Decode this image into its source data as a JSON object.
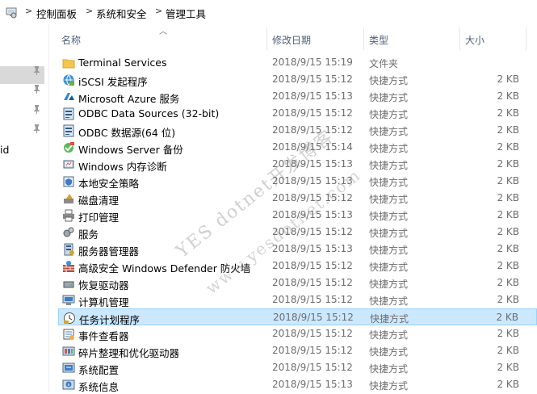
{
  "breadcrumb": {
    "items": [
      "控制面板",
      "系统和安全",
      "管理工具"
    ],
    "separator": ">"
  },
  "nav": {
    "fragment_text": "id"
  },
  "columns": {
    "name": "名称",
    "modified": "修改日期",
    "type": "类型",
    "size": "大小"
  },
  "files": [
    {
      "name": "Terminal Services",
      "modified": "2018/9/15 15:19",
      "type": "文件夹",
      "size": "",
      "icon": "folder-icon"
    },
    {
      "name": "iSCSI 发起程序",
      "modified": "2018/9/15 15:12",
      "type": "快捷方式",
      "size": "2 KB",
      "icon": "iscsi-icon"
    },
    {
      "name": "Microsoft Azure 服务",
      "modified": "2018/9/15 15:13",
      "type": "快捷方式",
      "size": "2 KB",
      "icon": "azure-icon"
    },
    {
      "name": "ODBC Data Sources (32-bit)",
      "modified": "2018/9/15 15:12",
      "type": "快捷方式",
      "size": "2 KB",
      "icon": "odbc-icon"
    },
    {
      "name": "ODBC 数据源(64 位)",
      "modified": "2018/9/15 15:12",
      "type": "快捷方式",
      "size": "2 KB",
      "icon": "odbc-icon"
    },
    {
      "name": "Windows Server 备份",
      "modified": "2018/9/15 15:14",
      "type": "快捷方式",
      "size": "2 KB",
      "icon": "backup-icon"
    },
    {
      "name": "Windows 内存诊断",
      "modified": "2018/9/15 15:13",
      "type": "快捷方式",
      "size": "2 KB",
      "icon": "memory-icon"
    },
    {
      "name": "本地安全策略",
      "modified": "2018/9/15 15:13",
      "type": "快捷方式",
      "size": "2 KB",
      "icon": "security-policy-icon"
    },
    {
      "name": "磁盘清理",
      "modified": "2018/9/15 15:12",
      "type": "快捷方式",
      "size": "2 KB",
      "icon": "disk-cleanup-icon"
    },
    {
      "name": "打印管理",
      "modified": "2018/9/15 15:13",
      "type": "快捷方式",
      "size": "2 KB",
      "icon": "printer-icon"
    },
    {
      "name": "服务",
      "modified": "2018/9/15 15:12",
      "type": "快捷方式",
      "size": "2 KB",
      "icon": "services-icon"
    },
    {
      "name": "服务器管理器",
      "modified": "2018/9/15 15:13",
      "type": "快捷方式",
      "size": "2 KB",
      "icon": "server-manager-icon"
    },
    {
      "name": "高级安全 Windows Defender 防火墙",
      "modified": "2018/9/15 15:12",
      "type": "快捷方式",
      "size": "2 KB",
      "icon": "firewall-icon"
    },
    {
      "name": "恢复驱动器",
      "modified": "2018/9/15 15:12",
      "type": "快捷方式",
      "size": "2 KB",
      "icon": "recovery-drive-icon"
    },
    {
      "name": "计算机管理",
      "modified": "2018/9/15 15:12",
      "type": "快捷方式",
      "size": "2 KB",
      "icon": "computer-management-icon"
    },
    {
      "name": "任务计划程序",
      "modified": "2018/9/15 15:12",
      "type": "快捷方式",
      "size": "2 KB",
      "icon": "task-scheduler-icon",
      "selected": true
    },
    {
      "name": "事件查看器",
      "modified": "2018/9/15 15:12",
      "type": "快捷方式",
      "size": "2 KB",
      "icon": "event-viewer-icon"
    },
    {
      "name": "碎片整理和优化驱动器",
      "modified": "2018/9/15 15:12",
      "type": "快捷方式",
      "size": "2 KB",
      "icon": "defrag-icon"
    },
    {
      "name": "系统配置",
      "modified": "2018/9/15 15:12",
      "type": "快捷方式",
      "size": "2 KB",
      "icon": "system-config-icon"
    },
    {
      "name": "系统信息",
      "modified": "2018/9/15 15:13",
      "type": "快捷方式",
      "size": "2 KB",
      "icon": "system-info-icon"
    }
  ],
  "watermark": {
    "line1": "YES dotnet开发博客",
    "line2": "www.yesdotnet.com"
  },
  "colors": {
    "selection_bg": "#cce8ff",
    "selection_border": "#99d1ff",
    "header_text": "#4c607a",
    "meta_text": "#6d6d6d",
    "folder": "#f5c64f"
  }
}
